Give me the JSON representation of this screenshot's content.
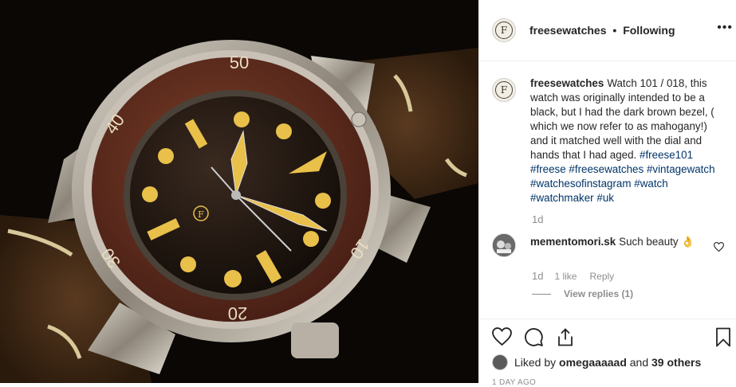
{
  "header": {
    "initial": "F",
    "username": "freesewatches",
    "separator": "•",
    "follow_state": "Following",
    "more": "•••"
  },
  "caption": {
    "initial": "F",
    "username": "freesewatches",
    "text": "Watch 101 / 018, this watch was originally intended to be a black, but I had the dark brown bezel, ( which we now refer to as mahogany!) and it matched well with the dial and hands that I had aged.",
    "hashtags": [
      "#freese101",
      "#freese",
      "#freesewatches",
      "#vintagewatch",
      "#watchesofinstagram",
      "#watch",
      "#watchmaker",
      "#uk"
    ],
    "time": "1d"
  },
  "comment": {
    "username": "mementomori.sk",
    "text": "Such beauty 👌",
    "time": "1d",
    "likes": "1 like",
    "reply_label": "Reply",
    "view_replies": "View replies (1)"
  },
  "likes": {
    "prefix": "Liked by",
    "user": "omegaaaaad",
    "middle": "and",
    "others": "39 others"
  },
  "date": "1 DAY AGO",
  "icons": [
    "heart-icon",
    "comment-icon",
    "share-icon",
    "bookmark-icon",
    "more-icon"
  ],
  "colors": {
    "link": "#003569",
    "muted": "#8e8e8e",
    "text": "#262626"
  },
  "watch": {
    "bezel_marks": [
      "50",
      "40",
      "30",
      "20",
      "10"
    ],
    "dial_logo": "F"
  }
}
